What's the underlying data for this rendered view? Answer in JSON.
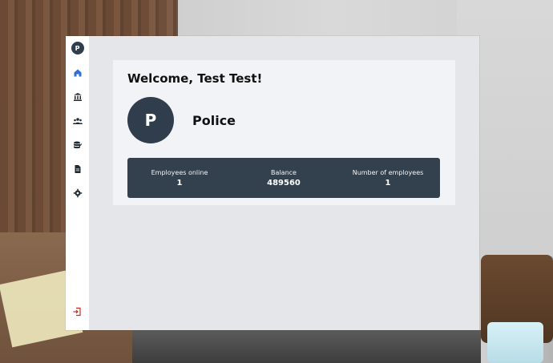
{
  "sidebar": {
    "avatar_letter": "P",
    "items": [
      {
        "icon": "home-icon",
        "active": true
      },
      {
        "icon": "bank-icon"
      },
      {
        "icon": "employees-icon"
      },
      {
        "icon": "coins-icon"
      },
      {
        "icon": "document-icon"
      },
      {
        "icon": "gear-icon"
      }
    ],
    "bottom": {
      "icon": "logout-icon"
    }
  },
  "header": {
    "welcome": "Welcome, Test Test!"
  },
  "org": {
    "avatar_letter": "P",
    "name": "Police"
  },
  "stats": [
    {
      "label": "Employees online",
      "value": "1"
    },
    {
      "label": "Balance",
      "value": "489560"
    },
    {
      "label": "Number of employees",
      "value": "1"
    }
  ],
  "colors": {
    "primary_dark": "#33404d",
    "active_icon": "#2f6fd6",
    "icon_default": "#1f2a33",
    "logout": "#c62828"
  }
}
